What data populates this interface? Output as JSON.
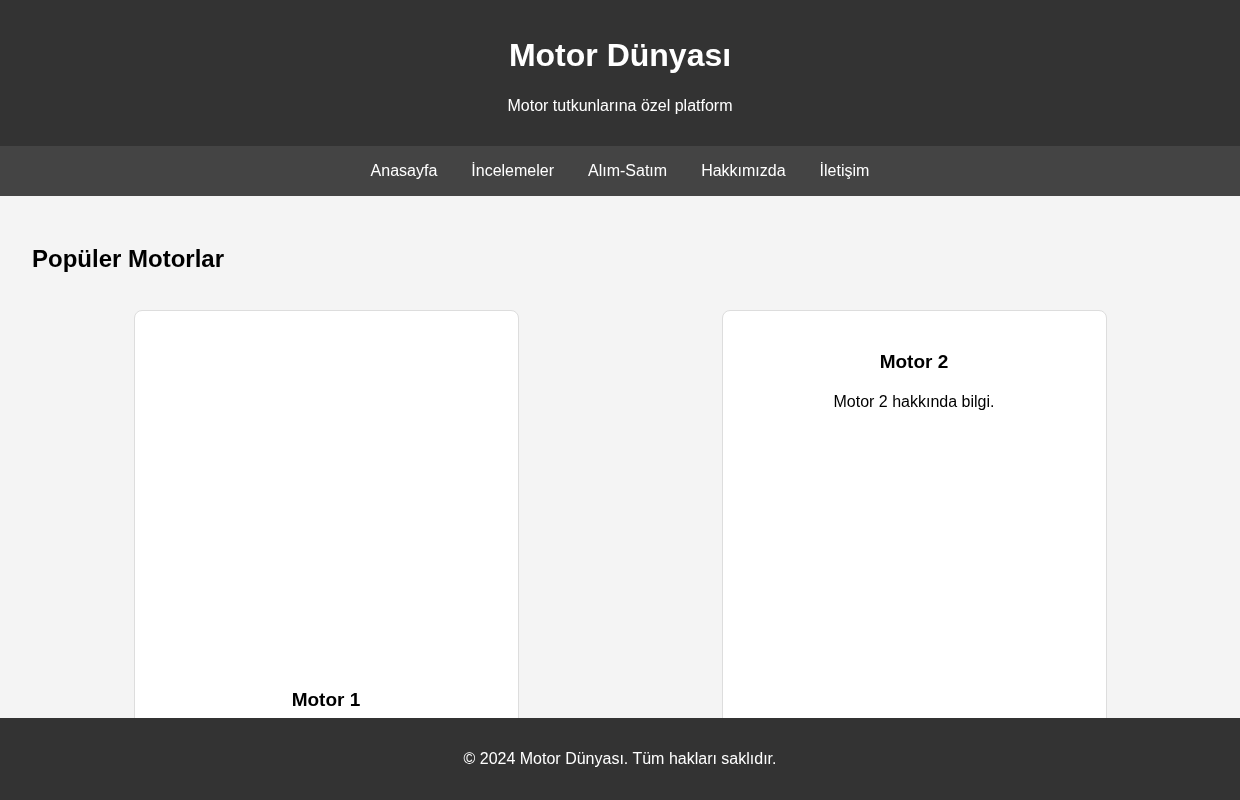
{
  "header": {
    "title": "Motor Dünyası",
    "subtitle": "Motor tutkunlarına özel platform"
  },
  "nav": [
    {
      "label": "Anasayfa"
    },
    {
      "label": "İncelemeler"
    },
    {
      "label": "Alım-Satım"
    },
    {
      "label": "Hakkımızda"
    },
    {
      "label": "İletişim"
    }
  ],
  "section": {
    "heading": "Popüler Motorlar"
  },
  "cards": [
    {
      "has_image": true,
      "title": "Motor 1"
    },
    {
      "has_image": false,
      "title": "Motor 2",
      "text": "Motor 2 hakkında bilgi."
    }
  ],
  "footer": {
    "text": "© 2024 Motor Dünyası. Tüm hakları saklıdır."
  }
}
